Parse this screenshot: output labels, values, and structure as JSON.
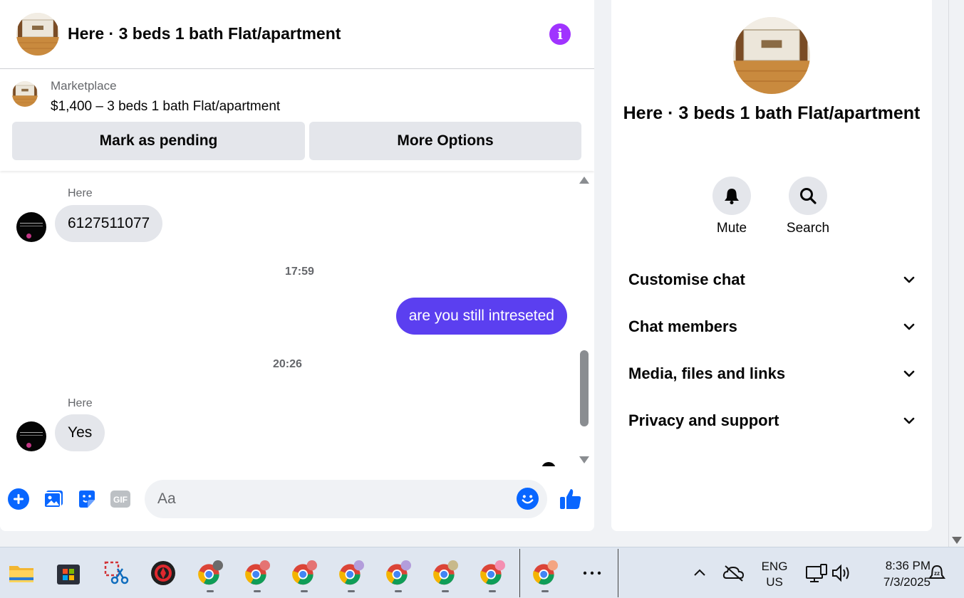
{
  "header": {
    "title": "Here · 3 beds 1 bath Flat/apartment"
  },
  "listing": {
    "category": "Marketplace",
    "title": "$1,400 – 3 beds 1 bath Flat/apartment",
    "mark_pending_label": "Mark as pending",
    "more_options_label": "More Options"
  },
  "messages": [
    {
      "sender": "Here",
      "text": "6127511077",
      "direction": "incoming"
    },
    {
      "timestamp": "17:59"
    },
    {
      "text": "are you still intreseted",
      "direction": "outgoing"
    },
    {
      "timestamp": "20:26"
    },
    {
      "sender": "Here",
      "text": "Yes",
      "direction": "incoming"
    }
  ],
  "composer": {
    "placeholder": "Aa"
  },
  "info_panel": {
    "title": "Here · 3 beds 1 bath Flat/apartment",
    "actions": [
      {
        "label": "Mute",
        "icon": "bell-icon"
      },
      {
        "label": "Search",
        "icon": "search-icon"
      }
    ],
    "sections": [
      {
        "label": "Customise chat"
      },
      {
        "label": "Chat members"
      },
      {
        "label": "Media, files and links"
      },
      {
        "label": "Privacy and support"
      }
    ]
  },
  "taskbar": {
    "language": "ENG",
    "region": "US",
    "time": "8:36 PM",
    "date": "7/3/2025"
  },
  "colors": {
    "outgoing_bubble": "#5b3ff0",
    "info_icon": "#a033ff",
    "accent_blue": "#0866ff"
  }
}
